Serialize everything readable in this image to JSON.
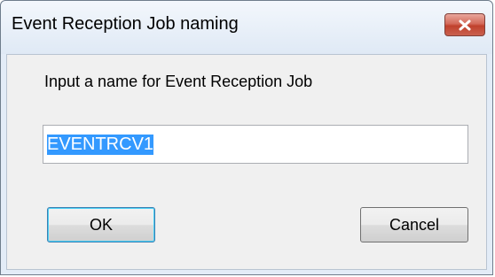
{
  "window": {
    "title": "Event Reception Job naming"
  },
  "dialog": {
    "prompt": "Input a name for Event Reception Job",
    "name_value": "EVENTRCV1",
    "ok_label": "OK",
    "cancel_label": "Cancel"
  },
  "icons": {
    "close": "close-icon"
  },
  "colors": {
    "close_button": "#c9483a",
    "selection_highlight": "#3399ff",
    "dialog_background": "#f0f0f0",
    "frame": "#e3ecf7"
  }
}
